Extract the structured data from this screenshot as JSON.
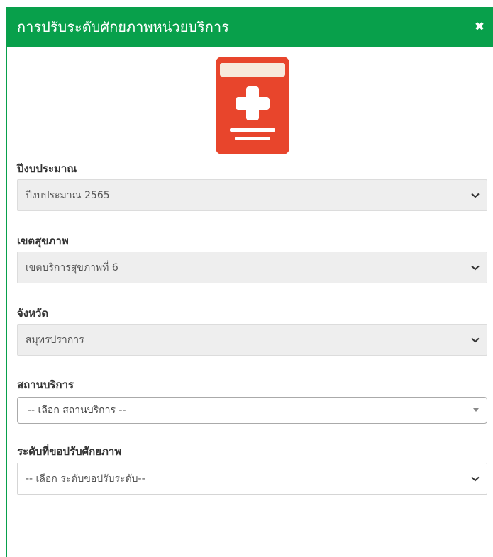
{
  "modal": {
    "title": "การปรับระดับศักยภาพหน่วยบริการ",
    "close_icon": "close-icon",
    "header_color": "#08a04b"
  },
  "logo": {
    "icon": "medical-book-icon",
    "color": "#e8452c"
  },
  "fields": {
    "budget_year": {
      "label": "ปีงบประมาณ",
      "value": "ปีงบประมาณ 2565"
    },
    "health_region": {
      "label": "เขตสุขภาพ",
      "value": "เขตบริการสุขภาพที่ 6"
    },
    "province": {
      "label": "จังหวัด",
      "value": "สมุทรปราการ"
    },
    "service_unit": {
      "label": "สถานบริการ",
      "value": "-- เลือก สถานบริการ --"
    },
    "capability_level": {
      "label": "ระดับที่ขอปรับศักยภาพ",
      "value": "-- เลือก ระดับขอปรับระดับ--"
    }
  }
}
